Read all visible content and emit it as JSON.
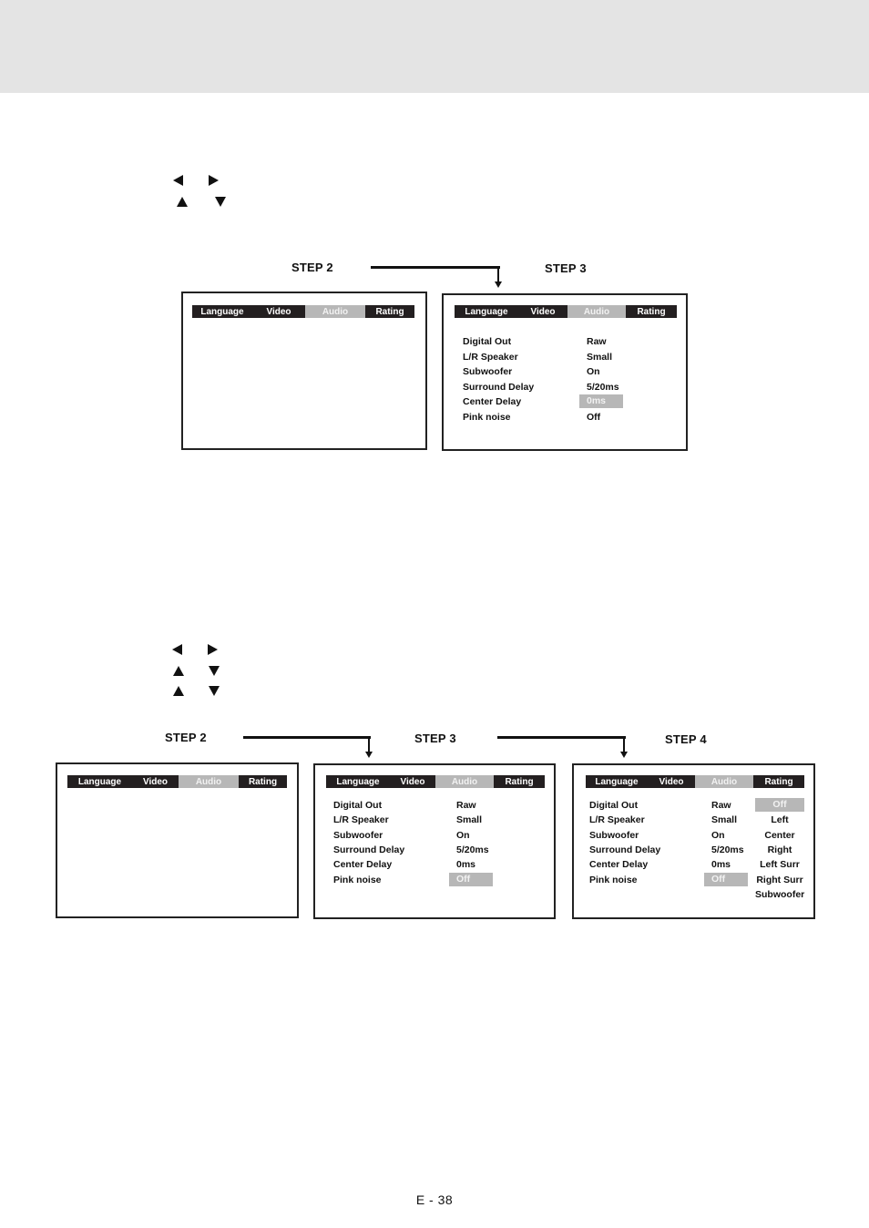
{
  "page": {
    "footer_page_number": "E - 38"
  },
  "section1": {
    "nav_icons": [
      "left-arrow",
      "right-arrow",
      "up-arrow",
      "down-arrow"
    ],
    "steps": [
      {
        "label": "STEP 2",
        "screen": {
          "tabs": [
            "Language",
            "Video",
            "Audio",
            "Rating"
          ],
          "active_tab": "Audio",
          "rows": []
        }
      },
      {
        "label": "STEP 3",
        "screen": {
          "tabs": [
            "Language",
            "Video",
            "Audio",
            "Rating"
          ],
          "active_tab": "Audio",
          "rows": [
            {
              "label": "Digital Out",
              "value": "Raw"
            },
            {
              "label": "L/R Speaker",
              "value": "Small"
            },
            {
              "label": "Subwoofer",
              "value": "On"
            },
            {
              "label": "Surround Delay",
              "value": "5/20ms"
            },
            {
              "label": "Center Delay",
              "value": "0ms",
              "highlighted": true
            },
            {
              "label": "Pink noise",
              "value": "Off"
            }
          ]
        }
      }
    ]
  },
  "section2": {
    "nav_icons": [
      "left-arrow",
      "right-arrow",
      "up-arrow",
      "down-arrow",
      "up-arrow",
      "down-arrow"
    ],
    "steps": [
      {
        "label": "STEP 2",
        "screen": {
          "tabs": [
            "Language",
            "Video",
            "Audio",
            "Rating"
          ],
          "active_tab": "Audio",
          "rows": []
        }
      },
      {
        "label": "STEP 3",
        "screen": {
          "tabs": [
            "Language",
            "Video",
            "Audio",
            "Rating"
          ],
          "active_tab": "Audio",
          "rows": [
            {
              "label": "Digital Out",
              "value": "Raw"
            },
            {
              "label": "L/R Speaker",
              "value": "Small"
            },
            {
              "label": "Subwoofer",
              "value": "On"
            },
            {
              "label": "Surround Delay",
              "value": "5/20ms"
            },
            {
              "label": "Center Delay",
              "value": "0ms"
            },
            {
              "label": "Pink noise",
              "value": "Off",
              "highlighted": true
            }
          ]
        }
      },
      {
        "label": "STEP 4",
        "screen": {
          "tabs": [
            "Language",
            "Video",
            "Audio",
            "Rating"
          ],
          "active_tab": "Audio",
          "rows": [
            {
              "label": "Digital Out",
              "value": "Raw"
            },
            {
              "label": "L/R Speaker",
              "value": "Small"
            },
            {
              "label": "Subwoofer",
              "value": "On"
            },
            {
              "label": "Surround Delay",
              "value": "5/20ms"
            },
            {
              "label": "Center Delay",
              "value": "0ms"
            },
            {
              "label": "Pink noise",
              "value": "Off",
              "highlighted": true
            }
          ],
          "options": [
            {
              "label": "Off",
              "highlighted": true
            },
            {
              "label": "Left"
            },
            {
              "label": "Center"
            },
            {
              "label": "Right"
            },
            {
              "label": "Left Surr"
            },
            {
              "label": "Right Surr"
            },
            {
              "label": "Subwoofer"
            }
          ]
        }
      }
    ]
  },
  "colors": {
    "header_band": "#e4e4e4",
    "tab_bg": "#231f20",
    "tab_active_bg": "#b7b7b7",
    "highlight_bg": "#b7b7b7"
  }
}
